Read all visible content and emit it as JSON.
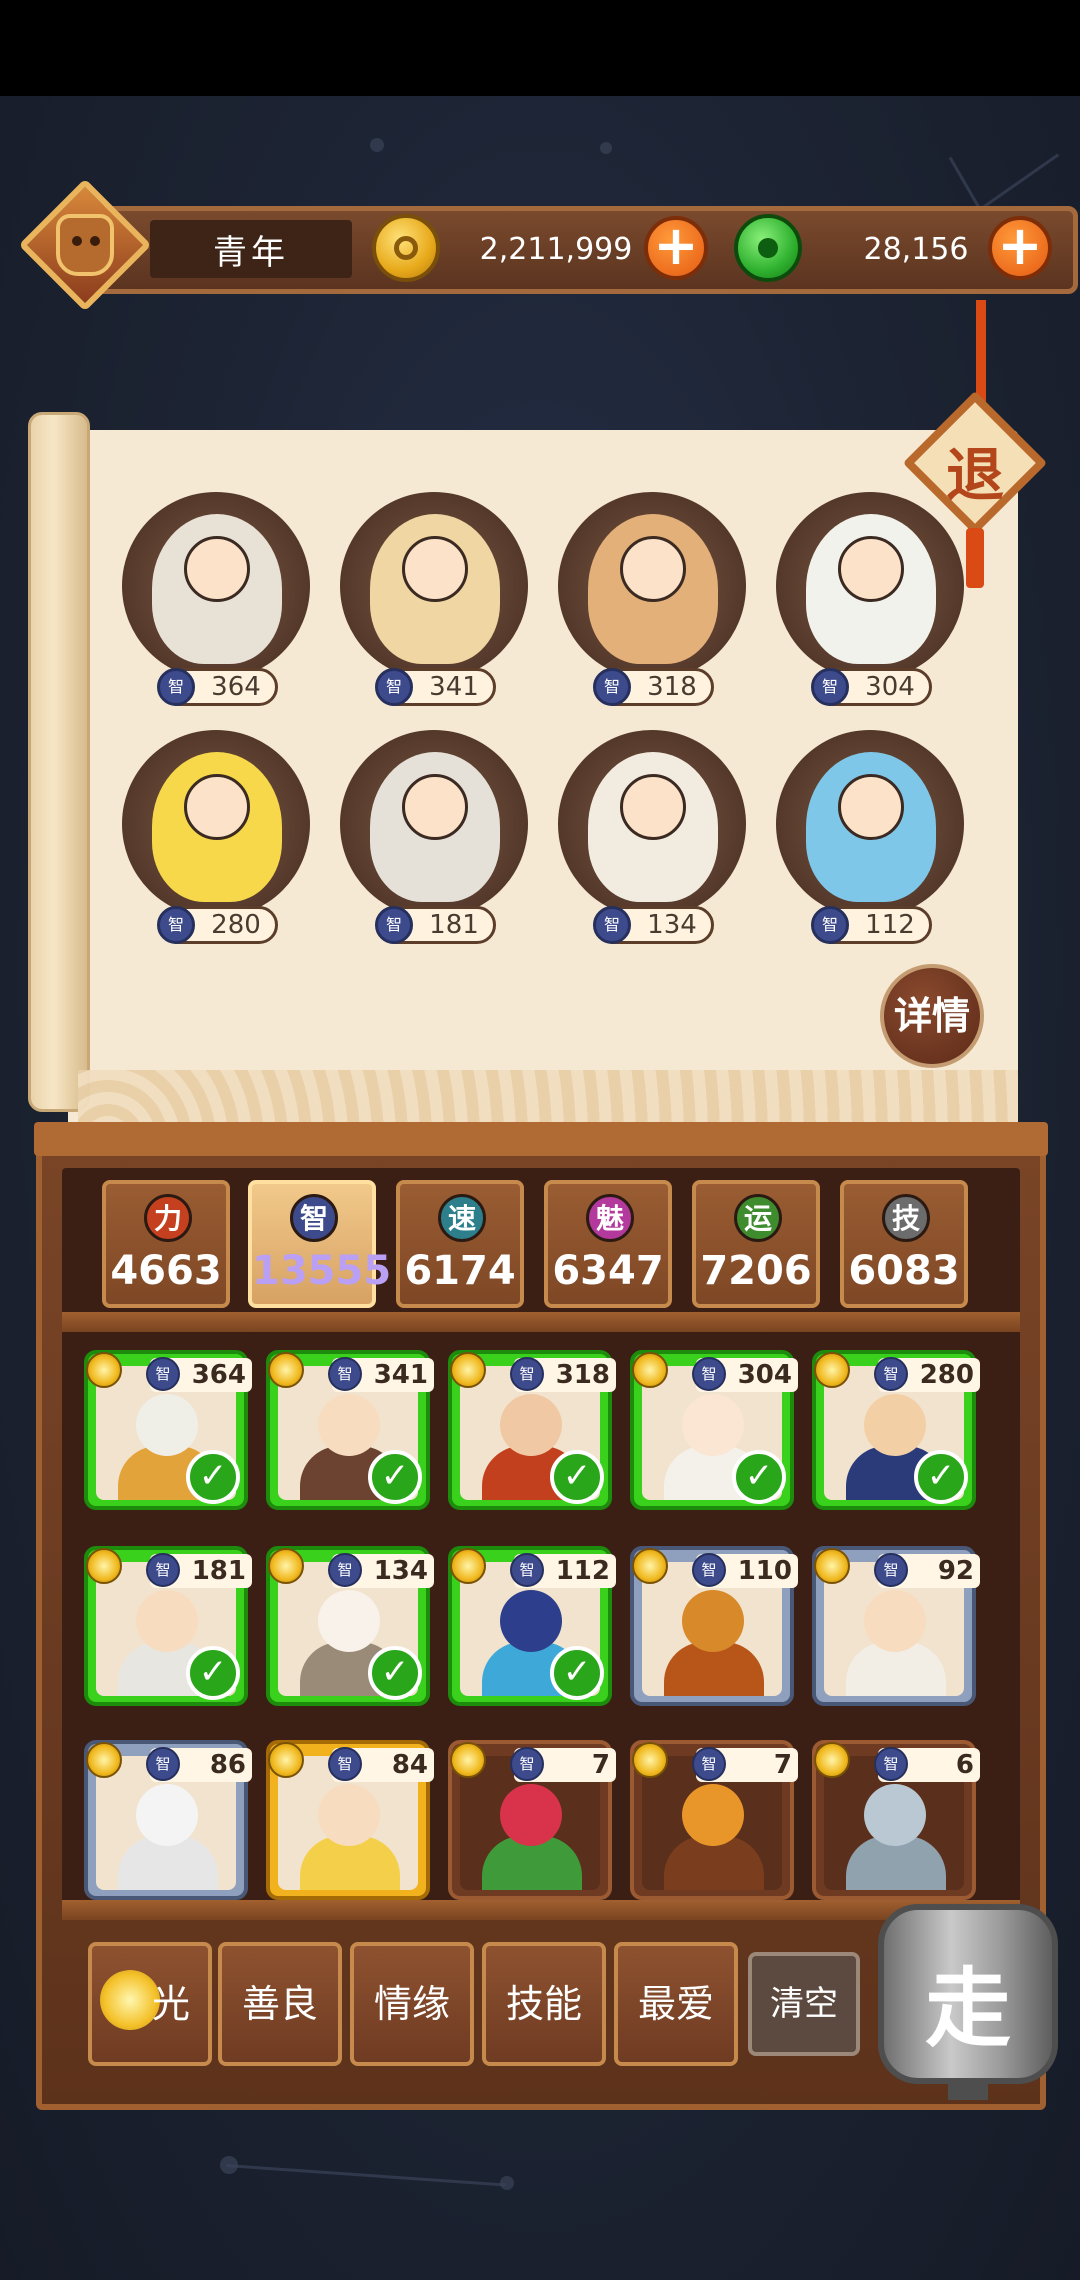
{
  "header": {
    "level_title": "青年",
    "coins": "2,211,999",
    "gems": "28,156",
    "plus_symbol": "+"
  },
  "scroll": {
    "exit_label": "退",
    "detail_label": "详情",
    "stat_glyph": "智",
    "heroes": [
      {
        "value": "364",
        "color": "#e8e1d6"
      },
      {
        "value": "341",
        "color": "#f0d6a2"
      },
      {
        "value": "318",
        "color": "#e3b07a"
      },
      {
        "value": "304",
        "color": "#f2f2ec"
      },
      {
        "value": "280",
        "color": "#f7d84a"
      },
      {
        "value": "181",
        "color": "#e6e1d8"
      },
      {
        "value": "134",
        "color": "#f2ece0"
      },
      {
        "value": "112",
        "color": "#7fc7e8"
      }
    ]
  },
  "stats": [
    {
      "glyph": "力",
      "value": "4663",
      "color": "#c4401e",
      "active": false
    },
    {
      "glyph": "智",
      "value": "13555",
      "color": "#3d4a8c",
      "active": true
    },
    {
      "glyph": "速",
      "value": "6174",
      "color": "#2e7f8c",
      "active": false
    },
    {
      "glyph": "魅",
      "value": "6347",
      "color": "#b33a9c",
      "active": false
    },
    {
      "glyph": "运",
      "value": "7206",
      "color": "#3e8c2e",
      "active": false
    },
    {
      "glyph": "技",
      "value": "6083",
      "color": "#6c6c6c",
      "active": false
    }
  ],
  "cards": [
    {
      "value": "364",
      "style": "sel",
      "checked": true,
      "head": "#efefe8",
      "body": "#e2a33a"
    },
    {
      "value": "341",
      "style": "sel",
      "checked": true,
      "head": "#f7dcc0",
      "body": "#6b4330"
    },
    {
      "value": "318",
      "style": "sel",
      "checked": true,
      "head": "#f0c9a4",
      "body": "#c2401e"
    },
    {
      "value": "304",
      "style": "sel",
      "checked": true,
      "head": "#fae6d2",
      "body": "#f4f1ea"
    },
    {
      "value": "280",
      "style": "sel",
      "checked": true,
      "head": "#f3cfa6",
      "body": "#2b3a78"
    },
    {
      "value": "181",
      "style": "sel",
      "checked": true,
      "head": "#f7dcc0",
      "body": "#e8e6e0"
    },
    {
      "value": "134",
      "style": "sel",
      "checked": true,
      "head": "#f8f2ea",
      "body": "#9a8a78"
    },
    {
      "value": "112",
      "style": "sel",
      "checked": true,
      "head": "#2d3f8c",
      "body": "#3ea9d8"
    },
    {
      "value": "110",
      "style": "blue",
      "checked": false,
      "head": "#d88a2a",
      "body": "#b8561a"
    },
    {
      "value": "92",
      "style": "blue",
      "checked": false,
      "head": "#f7dcc0",
      "body": "#f2eee6"
    },
    {
      "value": "86",
      "style": "blue",
      "checked": false,
      "head": "#f4f4f4",
      "body": "#e6e6e6"
    },
    {
      "value": "84",
      "style": "gold",
      "checked": false,
      "head": "#f7dcc0",
      "body": "#f4d04a"
    },
    {
      "value": "7",
      "style": "brown",
      "checked": false,
      "head": "#d8334a",
      "body": "#3f9a3a"
    },
    {
      "value": "7",
      "style": "brown",
      "checked": false,
      "head": "#e8962a",
      "body": "#7a3e1e"
    },
    {
      "value": "6",
      "style": "brown",
      "checked": false,
      "head": "#b9c8d2",
      "body": "#8fa2ae"
    }
  ],
  "filters": {
    "light": "光",
    "kind": "善良",
    "romance": "情缘",
    "skill": "技能",
    "favorite": "最爱",
    "clear": "清空",
    "go": "走"
  },
  "colors": {
    "wood": "#7a4527",
    "selected_green": "#39d11c",
    "accent_orange": "#e55a12"
  }
}
